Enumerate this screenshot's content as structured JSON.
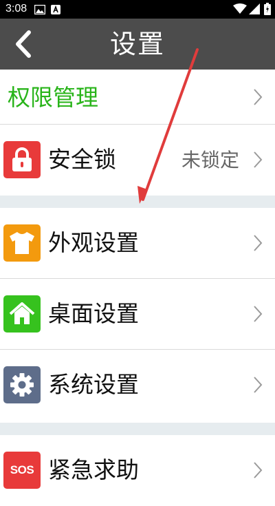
{
  "status_bar": {
    "time": "3:08"
  },
  "header": {
    "title": "设置"
  },
  "section1": {
    "permission_label": "权限管理",
    "lock_label": "安全锁",
    "lock_value": "未锁定"
  },
  "section2": {
    "appearance_label": "外观设置",
    "desktop_label": "桌面设置",
    "system_label": "系统设置"
  },
  "section3": {
    "sos_label": "紧急求助",
    "sos_icon_text": "SOS"
  },
  "icons": {
    "back": "chevron-left-icon",
    "lock": "lock-icon",
    "shirt": "shirt-icon",
    "home": "home-icon",
    "gear": "gear-icon",
    "sos": "sos-icon",
    "chevron": "chevron-right-icon"
  },
  "colors": {
    "header_bg": "#4c4c4c",
    "permission_green": "#29b41a",
    "lock_red": "#e83a3a",
    "shirt_orange": "#f39a0e",
    "home_green": "#36c21e",
    "gear_slate": "#5e6d8a",
    "sos_red": "#e83a3a",
    "annotation_arrow": "#e03c3c"
  }
}
